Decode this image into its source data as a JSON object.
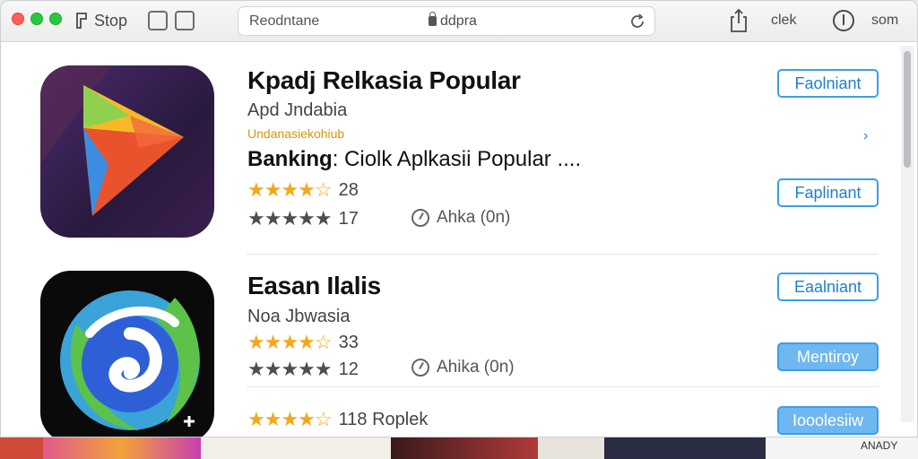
{
  "toolbar": {
    "stop_label": "Stop",
    "url_left": "Reodntane",
    "url_domain": "ddpra",
    "clek_label": "clek",
    "som_label": "som"
  },
  "apps": [
    {
      "title": "Kpadj Relkasia Popular",
      "subtitle": "Apd Jndabia",
      "tagline": "Undanasiekohiub",
      "line2_bold": "Banking",
      "line2_rest": ": Ciolk Aplkasii Popular ....",
      "rating_gold_text": "28",
      "rating_gray_text": "17",
      "meta_text": "Ahka (0n)",
      "button_top": "Faolniant",
      "button_mid": "Faplinant"
    },
    {
      "title": "Easan Ilalis",
      "subtitle": "Noa Jbwasia",
      "rating_gold_text": "33",
      "rating_gray_text": "12",
      "meta_text": "Ahika (0n)",
      "button_top": "Eaalniant",
      "button_mid": "Mentiroy",
      "bottom_rating_text": "118 Roplek",
      "button_bottom": "Iooolesiiw"
    }
  ],
  "stars": {
    "gold": "★★★★☆",
    "gray": "★★★★★"
  },
  "icons": [
    "traffic-lights",
    "stop-icon",
    "sidebar-icon",
    "tabs-icon",
    "lock-icon",
    "reload-icon",
    "share-icon",
    "info-icon",
    "chevron-right-icon"
  ],
  "bottom_badge": "ANADY",
  "colors": {
    "accent": "#3a9ee8",
    "star_gold": "#f3a81a",
    "star_gray": "#4e4e52"
  }
}
